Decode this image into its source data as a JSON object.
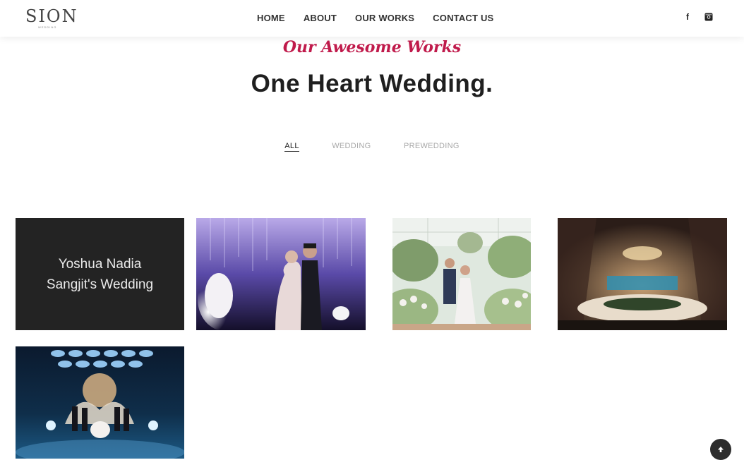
{
  "header": {
    "logo_text": "SION",
    "logo_subtext": "WEDDING",
    "nav": [
      "HOME",
      "ABOUT",
      "OUR WORKS",
      "CONTACT US"
    ],
    "social": {
      "facebook_glyph": "f",
      "facebook_icon": "facebook-icon",
      "instagram_icon": "instagram-icon"
    }
  },
  "section": {
    "subtitle": "Our Awesome Works",
    "title": "One Heart Wedding."
  },
  "filters": {
    "items": [
      "ALL",
      "WEDDING",
      "PREWEDDING"
    ],
    "active": "ALL"
  },
  "gallery": {
    "hover_caption_line1": "Yoshua Nadia",
    "hover_caption_line2": "Sangjit's Wedding",
    "items": [
      "gallery-photo-couple-lights",
      "gallery-photo-garden-couple",
      "gallery-photo-venue-hall",
      "gallery-photo-stage-ceremony"
    ]
  },
  "scroll_top": {
    "icon": "arrow-up-icon"
  },
  "colors": {
    "accent": "#c01a4b",
    "dark_tile": "#232323",
    "title": "#1f1f1f"
  }
}
